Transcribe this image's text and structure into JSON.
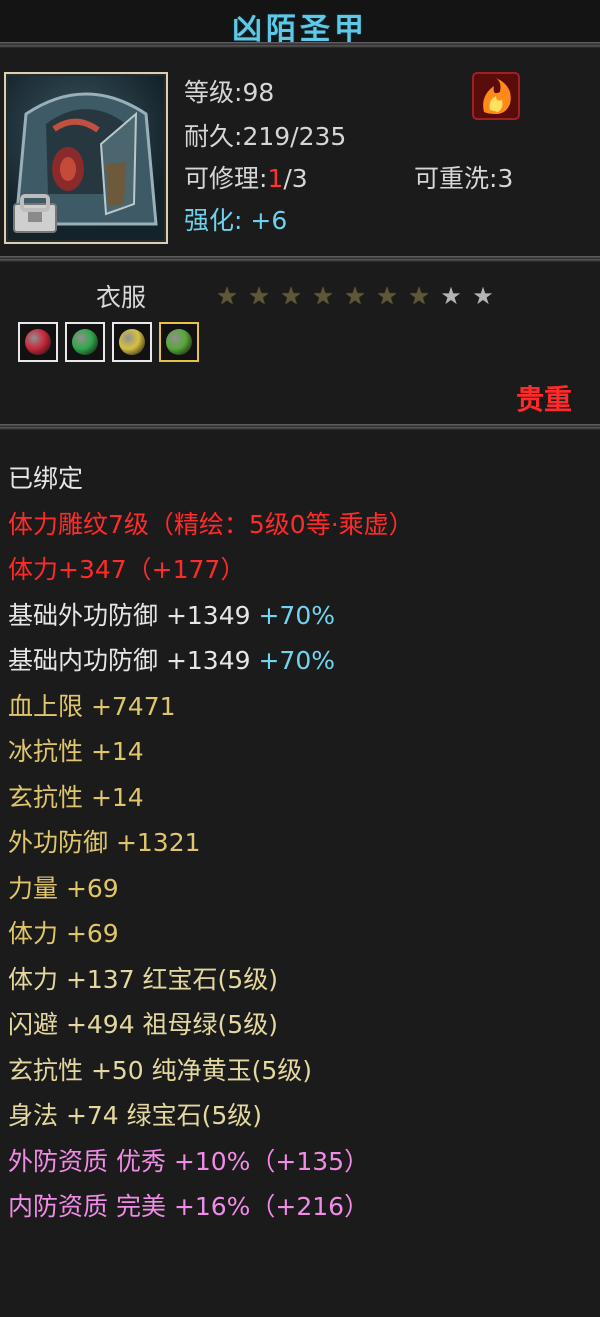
{
  "item": {
    "name": "凶陌圣甲",
    "level_label": "等级",
    "level_value": ":98",
    "durability_label": "耐久",
    "durability_value": ":219/235",
    "repair_label": "可修理",
    "repair_colon": ":",
    "repair_current": "1",
    "repair_max": "/3",
    "rewash_label": "可重洗",
    "rewash_value": ":3",
    "enhance_label": "强化",
    "enhance_colon": ":",
    "enhance_value": "+6",
    "slot": "衣服",
    "stars_total": 9,
    "stars_filled": 7,
    "tag": "贵重",
    "gem_colors": [
      "#c8283a",
      "#2fa84a",
      "#d8c040",
      "#58a838"
    ],
    "icons": {
      "portrait": "armor-portrait-icon",
      "lock": "lock-icon",
      "special": "fire-emblem-icon"
    }
  },
  "attributes": [
    {
      "parts": [
        {
          "text": "已绑定",
          "color": "white"
        }
      ]
    },
    {
      "parts": [
        {
          "text": "体力雕纹7级（精绘：5级0等·乘虚）",
          "color": "red"
        }
      ]
    },
    {
      "parts": [
        {
          "text": "体力+347（+177）",
          "color": "red"
        }
      ]
    },
    {
      "parts": [
        {
          "text": "基础外功防御 +1349 ",
          "color": "white"
        },
        {
          "text": "+70%",
          "color": "cyan"
        }
      ]
    },
    {
      "parts": [
        {
          "text": "基础内功防御 +1349 ",
          "color": "white"
        },
        {
          "text": "+70%",
          "color": "cyan"
        }
      ]
    },
    {
      "parts": [
        {
          "text": "血上限 +7471",
          "color": "gold"
        }
      ]
    },
    {
      "parts": [
        {
          "text": "冰抗性 +14",
          "color": "gold"
        }
      ]
    },
    {
      "parts": [
        {
          "text": "玄抗性 +14",
          "color": "gold"
        }
      ]
    },
    {
      "parts": [
        {
          "text": "外功防御 +1321",
          "color": "gold"
        }
      ]
    },
    {
      "parts": [
        {
          "text": "力量 +69",
          "color": "gold"
        }
      ]
    },
    {
      "parts": [
        {
          "text": "体力 +69",
          "color": "gold"
        }
      ]
    },
    {
      "parts": [
        {
          "text": "体力 +137 红宝石(5级)",
          "color": "gem"
        }
      ]
    },
    {
      "parts": [
        {
          "text": "闪避 +494 祖母绿(5级)",
          "color": "gem"
        }
      ]
    },
    {
      "parts": [
        {
          "text": "玄抗性 +50 纯净黄玉(5级)",
          "color": "gem"
        }
      ]
    },
    {
      "parts": [
        {
          "text": "身法 +74 绿宝石(5级)",
          "color": "gem"
        }
      ]
    },
    {
      "parts": [
        {
          "text": "外防资质  优秀 +10%（+135）",
          "color": "pink"
        }
      ]
    },
    {
      "parts": [
        {
          "text": "内防资质  完美 +16%（+216）",
          "color": "pink"
        }
      ]
    }
  ]
}
